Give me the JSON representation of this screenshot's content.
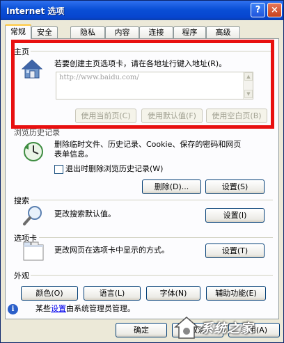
{
  "window": {
    "title": "Internet 选项"
  },
  "titlebar": {
    "help_glyph": "?",
    "close_glyph": "×"
  },
  "tabs": [
    "常规",
    "安全",
    "隐私",
    "内容",
    "连接",
    "程序",
    "高级"
  ],
  "home_page": {
    "group_label": "主页",
    "instruction": "若要创建主页选项卡，请在各地址行键入地址(R)。",
    "url_value": "http://www.baidu.com/",
    "btn_current": "使用当前页(C)",
    "btn_default": "使用默认值(F)",
    "btn_blank": "使用空白页(B)"
  },
  "history": {
    "group_label": "浏览历史记录",
    "desc_line1": "删除临时文件、历史记录、Cookie、保存的密码和网页",
    "desc_line2": "表单信息。",
    "checkbox_label": "退出时删除浏览历史记录(W)",
    "btn_delete": "删除(D)...",
    "btn_settings": "设置(S)"
  },
  "search": {
    "group_label": "搜索",
    "desc": "更改搜索默认值。",
    "btn_settings": "设置(I)"
  },
  "tabs_section": {
    "group_label": "选项卡",
    "desc": "更改网页在选项卡中显示的方式。",
    "btn_settings": "设置(T)"
  },
  "appearance": {
    "group_label": "外观",
    "btn_colors": "颜色(O)",
    "btn_languages": "语言(L)",
    "btn_fonts": "字体(N)",
    "btn_accessibility": "辅助功能(E)"
  },
  "info": {
    "prefix": "某些",
    "link": "设置",
    "suffix": "由系统管理员管理。"
  },
  "footer": {
    "btn_ok": "确定",
    "btn_cancel": "取消",
    "btn_apply": "应用(A)"
  },
  "watermark": {
    "text": "系统之家"
  },
  "colors": {
    "highlight": "#e81010",
    "title_bar": "#0a4fd6",
    "link": "#0000ee"
  }
}
